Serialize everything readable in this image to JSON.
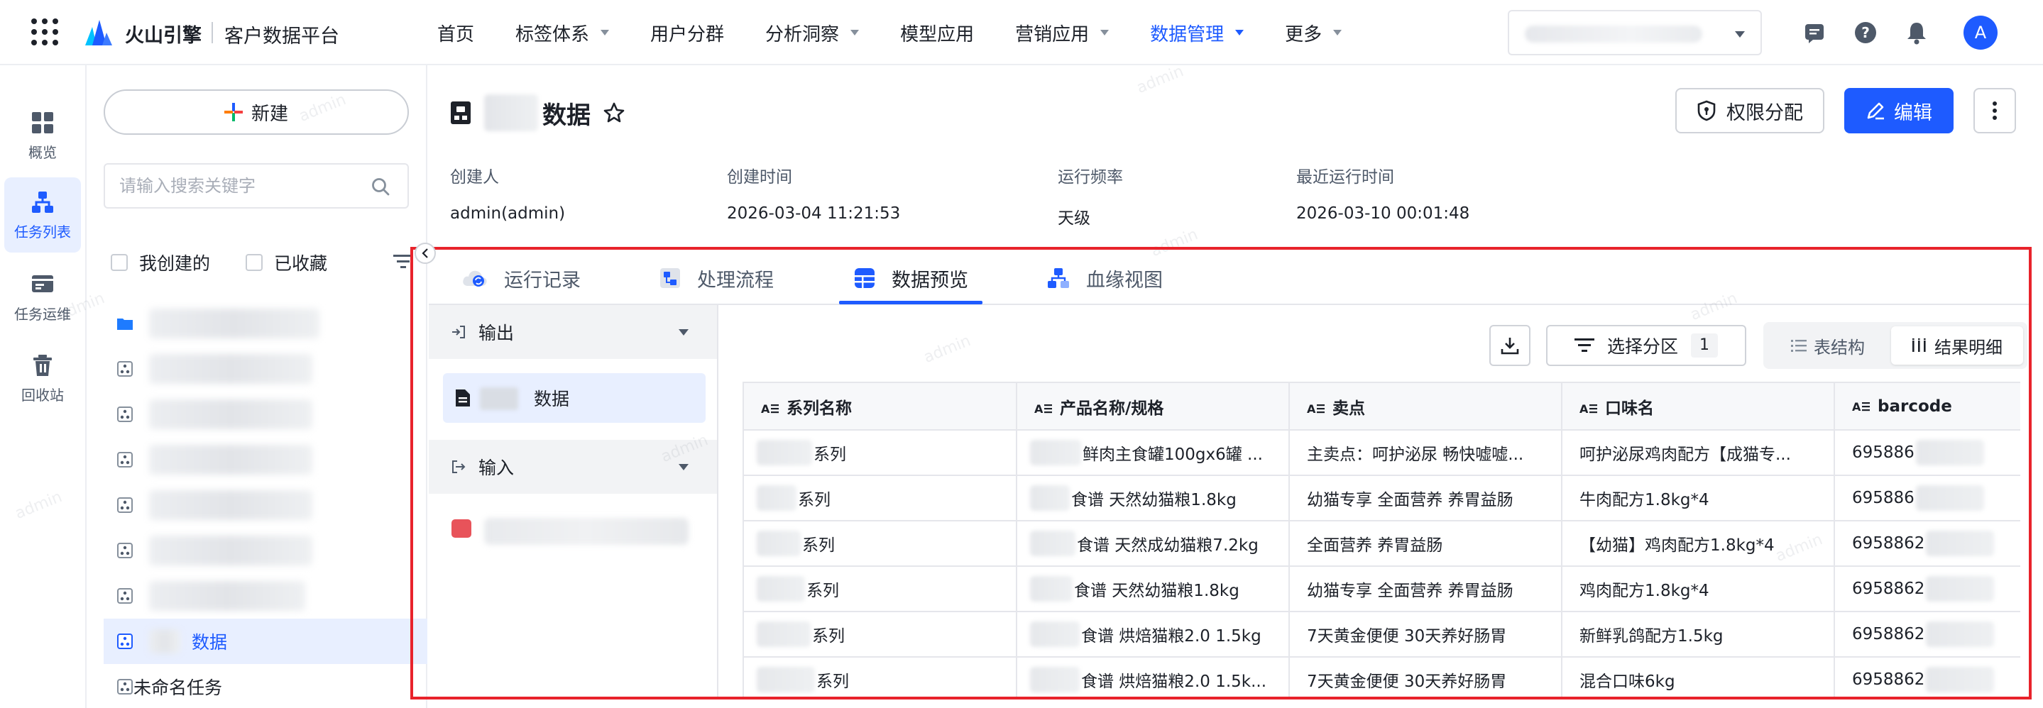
{
  "topbar": {
    "brand": "火山引擎",
    "product": "客户数据平台",
    "nav": [
      {
        "label": "首页",
        "caret": false,
        "active": false
      },
      {
        "label": "标签体系",
        "caret": true,
        "active": false
      },
      {
        "label": "用户分群",
        "caret": false,
        "active": false
      },
      {
        "label": "分析洞察",
        "caret": true,
        "active": false
      },
      {
        "label": "模型应用",
        "caret": false,
        "active": false
      },
      {
        "label": "营销应用",
        "caret": true,
        "active": false
      },
      {
        "label": "数据管理",
        "caret": true,
        "active": true
      },
      {
        "label": "更多",
        "caret": true,
        "active": false
      }
    ],
    "avatar_letter": "A",
    "icons": [
      "message-icon",
      "help-icon",
      "bell-icon"
    ]
  },
  "rail": {
    "items": [
      {
        "label": "概览",
        "icon": "grid-icon",
        "active": false
      },
      {
        "label": "任务列表",
        "icon": "hierarchy-icon",
        "active": true
      },
      {
        "label": "任务运维",
        "icon": "ops-icon",
        "active": false
      },
      {
        "label": "回收站",
        "icon": "trash-icon",
        "active": false
      }
    ]
  },
  "sidepanel": {
    "new_label": "新建",
    "search_placeholder": "请输入搜索关键字",
    "filter_mine": "我创建的",
    "filter_fav": "已收藏",
    "selected_task_label": "数据",
    "unnamed_task_label": "未命名任务"
  },
  "detail": {
    "title_suffix": "数据",
    "perm_label": "权限分配",
    "edit_label": "编辑",
    "meta": [
      {
        "label": "创建人",
        "value": "admin(admin)"
      },
      {
        "label": "创建时间",
        "value": "2026-03-04 11:21:53"
      },
      {
        "label": "运行频率",
        "value": "天级"
      },
      {
        "label": "最近运行时间",
        "value": "2026-03-10 00:01:48"
      }
    ],
    "tabs": [
      {
        "label": "运行记录",
        "icon": "cloud-sync-icon",
        "active": false
      },
      {
        "label": "处理流程",
        "icon": "flow-icon",
        "active": false
      },
      {
        "label": "数据预览",
        "icon": "table-icon",
        "active": true
      },
      {
        "label": "血缘视图",
        "icon": "lineage-icon",
        "active": false
      }
    ]
  },
  "preview": {
    "output_label": "输出",
    "output_item_label": "数据",
    "input_label": "输入",
    "partition_label": "选择分区",
    "partition_count": "1",
    "view_schema_label": "表结构",
    "view_result_label": "结果明细",
    "columns": [
      "系列名称",
      "产品名称/规格",
      "卖点",
      "口味名",
      "barcode"
    ],
    "rows": [
      [
        "系列",
        "鲜肉主食罐100gx6罐 ...",
        "主卖点：呵护泌尿 畅快嘘嘘...",
        "呵护泌尿鸡肉配方【成猫专...",
        "695886"
      ],
      [
        "系列",
        "食谱 天然幼猫粮1.8kg",
        "幼猫专享 全面营养 养胃益肠",
        "牛肉配方1.8kg*4",
        "695886"
      ],
      [
        "系列",
        "食谱 天然成幼猫粮7.2kg",
        "全面营养 养胃益肠",
        "【幼猫】鸡肉配方1.8kg*4",
        "6958862"
      ],
      [
        "系列",
        "食谱 天然幼猫粮1.8kg",
        "幼猫专享 全面营养 养胃益肠",
        "鸡肉配方1.8kg*4",
        "6958862"
      ],
      [
        "系列",
        "食谱 烘焙猫粮2.0 1.5kg",
        "7天黄金便便 30天养好肠胃",
        "新鲜乳鸽配方1.5kg",
        "6958862"
      ],
      [
        "系列",
        "食谱 烘焙猫粮2.0 1.5k...",
        "7天黄金便便 30天养好肠胃",
        "混合口味6kg",
        "6958862"
      ]
    ]
  },
  "watermark_text": "admin",
  "colors": {
    "accent": "#1e5bff",
    "highlight": "#e8232b",
    "selected_bg": "#e8efff"
  }
}
